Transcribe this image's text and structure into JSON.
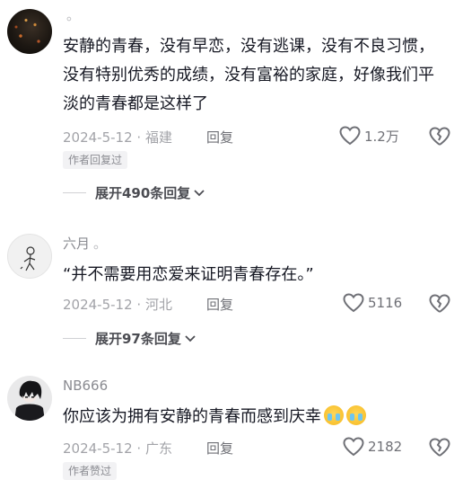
{
  "comments": [
    {
      "author": "",
      "more": "。",
      "text": "安静的青春，没有早恋，没有逃课，没有不良习惯，没有特别优秀的成绩，没有富裕的家庭，好像我们平淡的青春都是这样了",
      "date": "2024-5-12",
      "location": "福建",
      "reply_label": "回复",
      "likes": "1.2万",
      "badge": "作者回复过",
      "expand_label": "展开490条回复"
    },
    {
      "author": "六月",
      "more": "。",
      "text": "“并不需要用恋爱来证明青春存在。”",
      "date": "2024-5-12",
      "location": "河北",
      "reply_label": "回复",
      "likes": "5116",
      "expand_label": "展开97条回复"
    },
    {
      "author": "NB666",
      "text": "你应该为拥有安静的青春而感到庆幸",
      "emoji": [
        "loudly-crying-emoji",
        "loudly-crying-emoji"
      ],
      "date": "2024-5-12",
      "location": "广东",
      "reply_label": "回复",
      "likes": "2182",
      "badge": "作者赞过"
    }
  ],
  "icons": {
    "like": "heart-outline-icon",
    "dislike": "broken-heart-icon",
    "expand": "chevron-down-icon"
  },
  "colors": {
    "text": "#161823",
    "secondary": "#8a8b91",
    "meta": "#a2a3a8"
  }
}
